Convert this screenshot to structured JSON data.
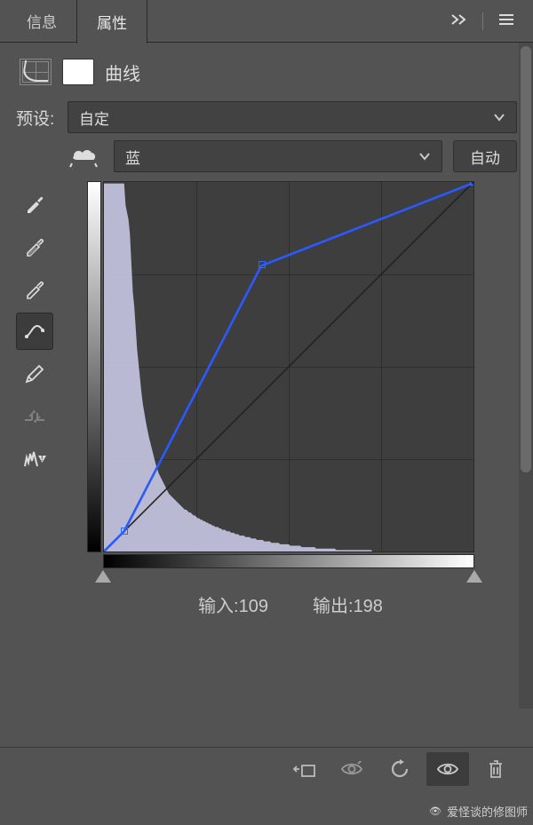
{
  "tabs": {
    "info": "信息",
    "properties": "属性"
  },
  "panel": {
    "title": "曲线"
  },
  "preset": {
    "label": "预设:",
    "value": "自定"
  },
  "channel": {
    "value": "蓝"
  },
  "auto_button": "自动",
  "io": {
    "input_label": "输入:",
    "input_value": "109",
    "output_label": "输出:",
    "output_value": "198"
  },
  "watermark": "爱怪谈的修图师",
  "chart_data": {
    "type": "line",
    "title": "曲线",
    "xlabel": "输入",
    "ylabel": "输出",
    "xlim": [
      0,
      255
    ],
    "ylim": [
      0,
      255
    ],
    "series": [
      {
        "name": "baseline",
        "x": [
          0,
          255
        ],
        "y": [
          0,
          255
        ]
      },
      {
        "name": "curve",
        "x": [
          0,
          14,
          109,
          255
        ],
        "y": [
          0,
          14,
          198,
          255
        ]
      }
    ],
    "points": [
      {
        "x": 14,
        "y": 14,
        "selected": false
      },
      {
        "x": 109,
        "y": 198,
        "selected": false
      },
      {
        "x": 255,
        "y": 255,
        "selected": false
      }
    ],
    "histogram_channel": "blue",
    "histogram_approx_bins": [
      255,
      255,
      255,
      255,
      255,
      255,
      255,
      255,
      255,
      255,
      255,
      255,
      255,
      255,
      255,
      240,
      235,
      230,
      220,
      200,
      180,
      170,
      155,
      140,
      130,
      120,
      110,
      102,
      96,
      90,
      85,
      80,
      76,
      72,
      68,
      64,
      60,
      57,
      54,
      52,
      50,
      48,
      46,
      44,
      42,
      40,
      39,
      38,
      37,
      36,
      35,
      34,
      33,
      32,
      31,
      30,
      29,
      29,
      28,
      27,
      27,
      26,
      25,
      25,
      24,
      23,
      23,
      22,
      22,
      21,
      21,
      20,
      20,
      19,
      19,
      18,
      18,
      17,
      17,
      17,
      16,
      16,
      15,
      15,
      15,
      14,
      14,
      14,
      13,
      13,
      13,
      12,
      12,
      12,
      11,
      11,
      11,
      11,
      10,
      10,
      10,
      10,
      9,
      9,
      9,
      9,
      8,
      8,
      8,
      8,
      8,
      7,
      7,
      7,
      7,
      7,
      6,
      6,
      6,
      6,
      6,
      6,
      5,
      5,
      5,
      5,
      5,
      5,
      5,
      4,
      4,
      4,
      4,
      4,
      4,
      4,
      4,
      3,
      3,
      3,
      3,
      3,
      3,
      3,
      3,
      3,
      3,
      2,
      2,
      2,
      2,
      2,
      2,
      2,
      2,
      2,
      2,
      2,
      2,
      2,
      2,
      1,
      1,
      1,
      1,
      1,
      1,
      1,
      1,
      1,
      1,
      1,
      1,
      1,
      1,
      1,
      1,
      1,
      1,
      1,
      1,
      1,
      1,
      1,
      1,
      1,
      0,
      0,
      0,
      0,
      0,
      0,
      0,
      0,
      0,
      0,
      0,
      0,
      0,
      0,
      0,
      0,
      0,
      0,
      0,
      0,
      0,
      0,
      0,
      0,
      0,
      0,
      0,
      0,
      0,
      0,
      0,
      0,
      0,
      0,
      0,
      0,
      0,
      0,
      0,
      0,
      0,
      0,
      0,
      0,
      0,
      0,
      0,
      0,
      0,
      0,
      0,
      0,
      0,
      0,
      0,
      0,
      0,
      0,
      0,
      0,
      0,
      0,
      0,
      0,
      0,
      0,
      0,
      0,
      0,
      0
    ]
  }
}
